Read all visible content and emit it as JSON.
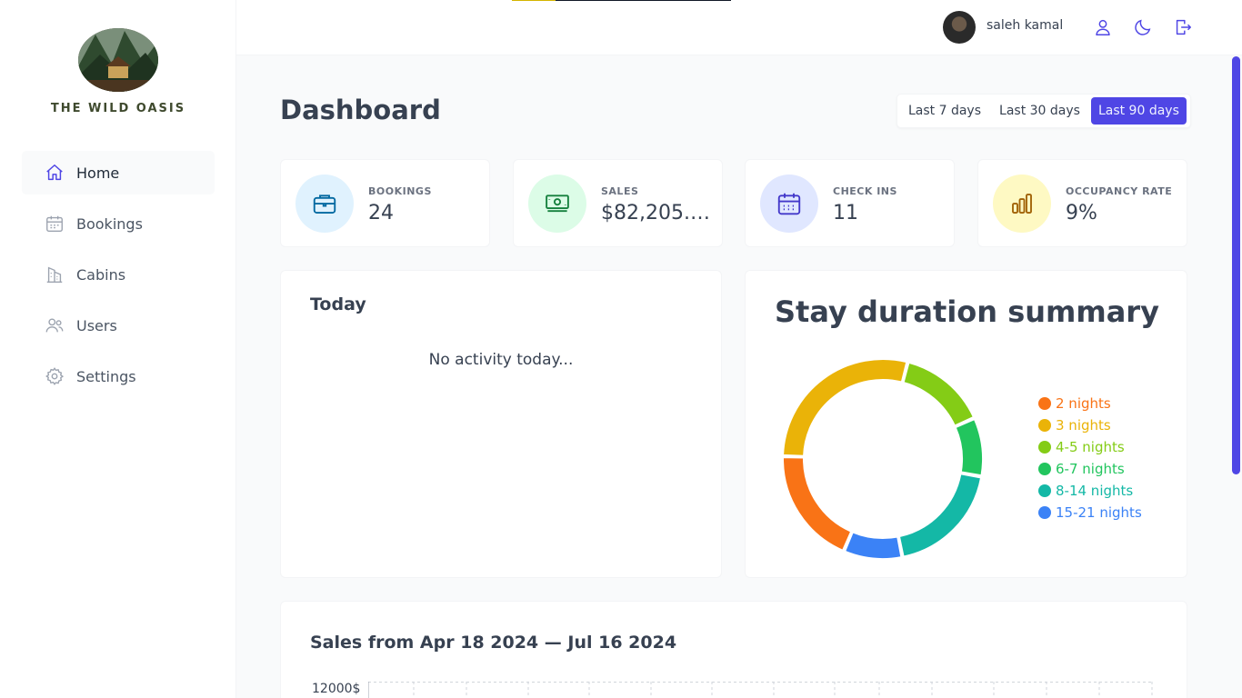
{
  "app": {
    "brand": "THE WILD OASIS"
  },
  "sidebar": {
    "items": [
      {
        "label": "Home",
        "icon": "home-icon",
        "active": true
      },
      {
        "label": "Bookings",
        "icon": "calendar-icon",
        "active": false
      },
      {
        "label": "Cabins",
        "icon": "building-icon",
        "active": false
      },
      {
        "label": "Users",
        "icon": "users-icon",
        "active": false
      },
      {
        "label": "Settings",
        "icon": "gear-icon",
        "active": false
      }
    ]
  },
  "header": {
    "username": "saleh kamal",
    "icons": [
      "user-icon",
      "moon-icon",
      "logout-icon"
    ]
  },
  "dashboard": {
    "title": "Dashboard",
    "filters": [
      {
        "label": "Last 7 days",
        "active": false
      },
      {
        "label": "Last 30 days",
        "active": false
      },
      {
        "label": "Last 90 days",
        "active": true
      }
    ],
    "stats": [
      {
        "label": "BOOKINGS",
        "value": "24",
        "icon": "briefcase-icon",
        "bg": "#e0f2fe",
        "color": "#0369a1"
      },
      {
        "label": "SALES",
        "value": "$82,205.…",
        "icon": "banknotes-icon",
        "bg": "#dcfce7",
        "color": "#15803d"
      },
      {
        "label": "CHECK INS",
        "value": "11",
        "icon": "calendar-days-icon",
        "bg": "#e0e7ff",
        "color": "#4338ca"
      },
      {
        "label": "OCCUPANCY RATE",
        "value": "9%",
        "icon": "chart-bar-icon",
        "bg": "#fef9c3",
        "color": "#a16207"
      }
    ]
  },
  "today": {
    "title": "Today",
    "empty_text": "No activity today..."
  },
  "stay_duration": {
    "title": "Stay duration summary"
  },
  "chart_data": {
    "type": "pie",
    "title": "Stay duration summary",
    "categories": [
      "2 nights",
      "3 nights",
      "4-5 nights",
      "6-7 nights",
      "8-14 nights",
      "15-21 nights"
    ],
    "values": [
      4,
      6,
      3,
      2,
      4,
      2
    ],
    "colors": [
      "#f97316",
      "#eab308",
      "#84cc16",
      "#22c55e",
      "#14b8a6",
      "#3b82f6"
    ],
    "legend": "right"
  },
  "sales": {
    "title": "Sales from Apr 18 2024 — Jul 16 2024",
    "y_tick_top": "12000$"
  }
}
